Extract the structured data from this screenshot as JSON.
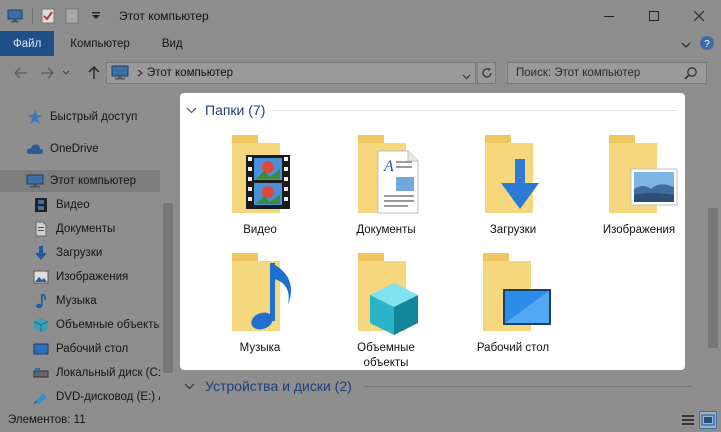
{
  "window": {
    "title": "Этот компьютер"
  },
  "ribbon": {
    "tabs": [
      {
        "label": "Файл"
      },
      {
        "label": "Компьютер"
      },
      {
        "label": "Вид"
      }
    ]
  },
  "address": {
    "path": "Этот компьютер",
    "search_placeholder": "Поиск: Этот компьютер"
  },
  "sidebar": {
    "items": [
      {
        "label": "Быстрый доступ",
        "icon": "star-icon"
      },
      {
        "label": "OneDrive",
        "icon": "cloud-icon"
      },
      {
        "label": "Этот компьютер",
        "icon": "monitor-icon",
        "selected": true
      },
      {
        "label": "Видео",
        "icon": "film-icon"
      },
      {
        "label": "Документы",
        "icon": "document-icon"
      },
      {
        "label": "Загрузки",
        "icon": "download-arrow-icon"
      },
      {
        "label": "Изображения",
        "icon": "picture-icon"
      },
      {
        "label": "Музыка",
        "icon": "music-note-icon"
      },
      {
        "label": "Объемные объекты",
        "icon": "cube-icon"
      },
      {
        "label": "Рабочий стол",
        "icon": "desktop-icon"
      },
      {
        "label": "Локальный диск (C:)",
        "icon": "hard-drive-icon"
      },
      {
        "label": "DVD-дисковод (E:) A",
        "icon": "dvd-drive-icon"
      }
    ]
  },
  "folders_group": {
    "title": "Папки (7)",
    "items": [
      {
        "label": "Видео",
        "icon": "video-folder-icon"
      },
      {
        "label": "Документы",
        "icon": "documents-folder-icon"
      },
      {
        "label": "Загрузки",
        "icon": "downloads-folder-icon"
      },
      {
        "label": "Изображения",
        "icon": "pictures-folder-icon"
      },
      {
        "label": "Музыка",
        "icon": "music-folder-icon"
      },
      {
        "label": "Объемные объекты",
        "icon": "3d-objects-folder-icon"
      },
      {
        "label": "Рабочий стол",
        "icon": "desktop-folder-icon"
      }
    ]
  },
  "devices_group": {
    "title": "Устройства и диски (2)"
  },
  "status": {
    "items_text": "Элементов: 11"
  },
  "colors": {
    "accent": "#1e4f86",
    "group_title": "#1e3e7a",
    "folder_yellow": "#f5d77e",
    "overlay_gray": "#8e8e8e"
  }
}
